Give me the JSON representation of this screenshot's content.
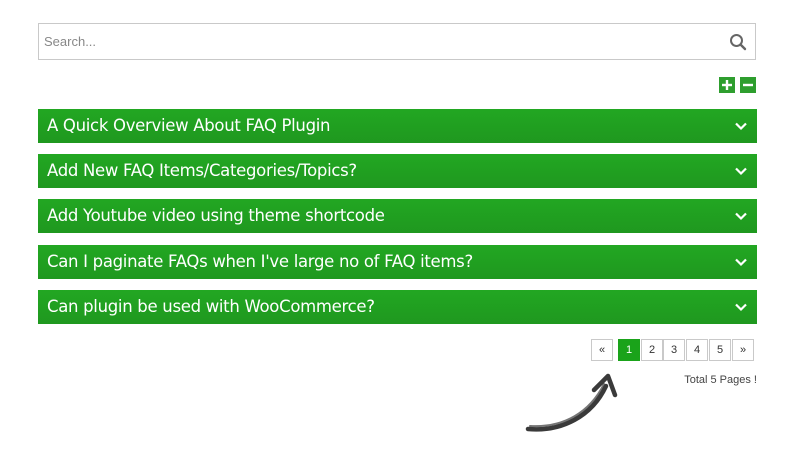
{
  "search": {
    "placeholder": "Search..."
  },
  "accordion": {
    "items": [
      {
        "title": "A Quick Overview About FAQ Plugin"
      },
      {
        "title": "Add New FAQ Items/Categories/Topics?"
      },
      {
        "title": "Add Youtube video using theme shortcode"
      },
      {
        "title": "Can I paginate FAQs when I've large no of FAQ items?"
      },
      {
        "title": "Can plugin be used with WooCommerce?"
      }
    ]
  },
  "pagination": {
    "prev": "«",
    "pages": [
      "1",
      "2",
      "3",
      "4",
      "5"
    ],
    "next": "»",
    "current_page": 1,
    "total_text": "Total 5 Pages !"
  },
  "colors": {
    "accent": "#1aa31a",
    "accordion_bg": "#22a722",
    "border": "#c9c9c9"
  },
  "icons": {
    "search": "search-icon",
    "expand_all": "plus-icon",
    "collapse_all": "minus-icon",
    "chevron": "chevron-down-icon"
  }
}
